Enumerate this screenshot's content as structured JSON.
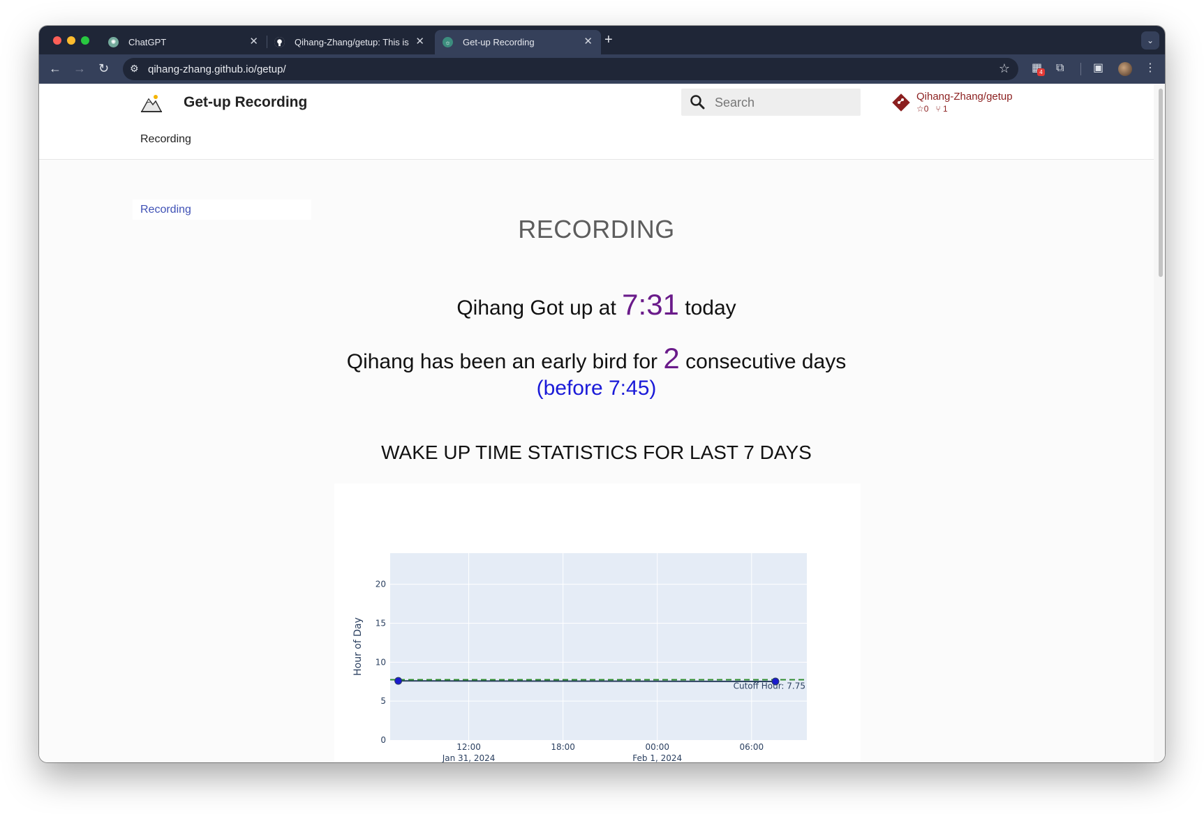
{
  "browser": {
    "tabs": [
      {
        "title": "ChatGPT",
        "active": false
      },
      {
        "title": "Qihang-Zhang/getup: This is",
        "active": false
      },
      {
        "title": "Get-up Recording",
        "active": true
      }
    ],
    "new_tab": "+",
    "url": "qihang-zhang.github.io/getup/"
  },
  "site": {
    "title": "Get-up Recording",
    "search_placeholder": "Search",
    "repo": {
      "name": "Qihang-Zhang/getup",
      "stars": "0",
      "forks": "1"
    },
    "nav_item": "Recording",
    "sidebar_item": "Recording"
  },
  "main": {
    "heading": "RECORDING",
    "wake_prefix": "Qihang Got up at",
    "wake_time": "7:31",
    "wake_suffix": "today",
    "streak_prefix": "Qihang has been an early bird for",
    "streak_days": "2",
    "streak_suffix": "consecutive days",
    "cutoff_note": "(before 7:45)",
    "stats_heading": "WAKE UP TIME STATISTICS FOR LAST 7 DAYS"
  },
  "chart_data": {
    "type": "scatter",
    "ylabel": "Hour of Day",
    "xlabel": "",
    "ylim": [
      0,
      24
    ],
    "y_ticks": [
      0,
      5,
      10,
      15,
      20
    ],
    "x_ticks": [
      {
        "label": "12:00",
        "sub": "Jan 31, 2024",
        "t": "2024-01-31T12:00"
      },
      {
        "label": "18:00",
        "sub": "",
        "t": "2024-01-31T18:00"
      },
      {
        "label": "00:00",
        "sub": "Feb 1, 2024",
        "t": "2024-02-01T00:00"
      },
      {
        "label": "06:00",
        "sub": "",
        "t": "2024-02-01T06:00"
      }
    ],
    "xlim": [
      "2024-01-31T07:00",
      "2024-02-01T09:31"
    ],
    "points": [
      {
        "t": "2024-01-31T07:31",
        "y": 7.6
      },
      {
        "t": "2024-02-01T07:31",
        "y": 7.52
      }
    ],
    "cutoff": {
      "y": 7.75,
      "label": "Cutoff Hour: 7.75"
    },
    "colors": {
      "plot_bg": "#e5ecf6",
      "point": "#1a1acc",
      "line": "#2a3f5f",
      "cutoff": "#2e8b2e"
    }
  }
}
